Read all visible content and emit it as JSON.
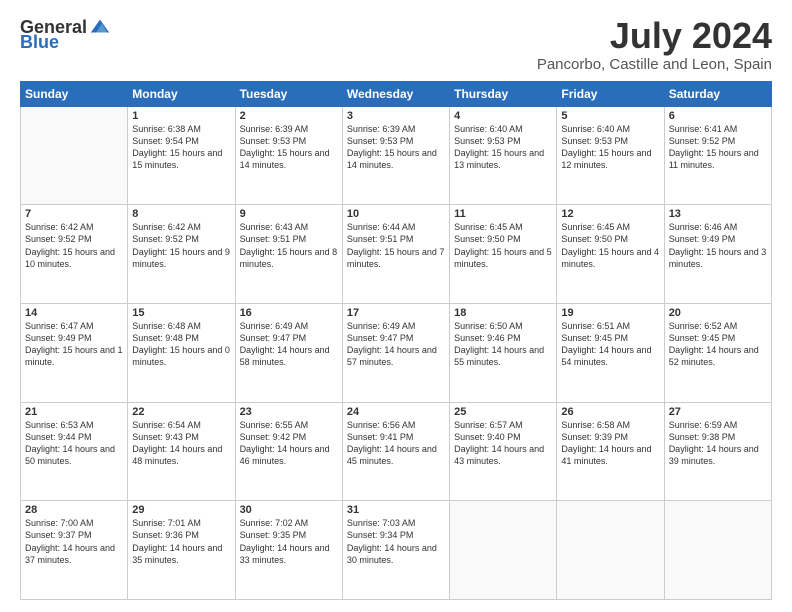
{
  "logo": {
    "general": "General",
    "blue": "Blue"
  },
  "title": "July 2024",
  "location": "Pancorbo, Castille and Leon, Spain",
  "weekdays": [
    "Sunday",
    "Monday",
    "Tuesday",
    "Wednesday",
    "Thursday",
    "Friday",
    "Saturday"
  ],
  "weeks": [
    [
      {
        "day": "",
        "sunrise": "",
        "sunset": "",
        "daylight": "",
        "empty": true
      },
      {
        "day": "1",
        "sunrise": "Sunrise: 6:38 AM",
        "sunset": "Sunset: 9:54 PM",
        "daylight": "Daylight: 15 hours and 15 minutes."
      },
      {
        "day": "2",
        "sunrise": "Sunrise: 6:39 AM",
        "sunset": "Sunset: 9:53 PM",
        "daylight": "Daylight: 15 hours and 14 minutes."
      },
      {
        "day": "3",
        "sunrise": "Sunrise: 6:39 AM",
        "sunset": "Sunset: 9:53 PM",
        "daylight": "Daylight: 15 hours and 14 minutes."
      },
      {
        "day": "4",
        "sunrise": "Sunrise: 6:40 AM",
        "sunset": "Sunset: 9:53 PM",
        "daylight": "Daylight: 15 hours and 13 minutes."
      },
      {
        "day": "5",
        "sunrise": "Sunrise: 6:40 AM",
        "sunset": "Sunset: 9:53 PM",
        "daylight": "Daylight: 15 hours and 12 minutes."
      },
      {
        "day": "6",
        "sunrise": "Sunrise: 6:41 AM",
        "sunset": "Sunset: 9:52 PM",
        "daylight": "Daylight: 15 hours and 11 minutes."
      }
    ],
    [
      {
        "day": "7",
        "sunrise": "Sunrise: 6:42 AM",
        "sunset": "Sunset: 9:52 PM",
        "daylight": "Daylight: 15 hours and 10 minutes."
      },
      {
        "day": "8",
        "sunrise": "Sunrise: 6:42 AM",
        "sunset": "Sunset: 9:52 PM",
        "daylight": "Daylight: 15 hours and 9 minutes."
      },
      {
        "day": "9",
        "sunrise": "Sunrise: 6:43 AM",
        "sunset": "Sunset: 9:51 PM",
        "daylight": "Daylight: 15 hours and 8 minutes."
      },
      {
        "day": "10",
        "sunrise": "Sunrise: 6:44 AM",
        "sunset": "Sunset: 9:51 PM",
        "daylight": "Daylight: 15 hours and 7 minutes."
      },
      {
        "day": "11",
        "sunrise": "Sunrise: 6:45 AM",
        "sunset": "Sunset: 9:50 PM",
        "daylight": "Daylight: 15 hours and 5 minutes."
      },
      {
        "day": "12",
        "sunrise": "Sunrise: 6:45 AM",
        "sunset": "Sunset: 9:50 PM",
        "daylight": "Daylight: 15 hours and 4 minutes."
      },
      {
        "day": "13",
        "sunrise": "Sunrise: 6:46 AM",
        "sunset": "Sunset: 9:49 PM",
        "daylight": "Daylight: 15 hours and 3 minutes."
      }
    ],
    [
      {
        "day": "14",
        "sunrise": "Sunrise: 6:47 AM",
        "sunset": "Sunset: 9:49 PM",
        "daylight": "Daylight: 15 hours and 1 minute."
      },
      {
        "day": "15",
        "sunrise": "Sunrise: 6:48 AM",
        "sunset": "Sunset: 9:48 PM",
        "daylight": "Daylight: 15 hours and 0 minutes."
      },
      {
        "day": "16",
        "sunrise": "Sunrise: 6:49 AM",
        "sunset": "Sunset: 9:47 PM",
        "daylight": "Daylight: 14 hours and 58 minutes."
      },
      {
        "day": "17",
        "sunrise": "Sunrise: 6:49 AM",
        "sunset": "Sunset: 9:47 PM",
        "daylight": "Daylight: 14 hours and 57 minutes."
      },
      {
        "day": "18",
        "sunrise": "Sunrise: 6:50 AM",
        "sunset": "Sunset: 9:46 PM",
        "daylight": "Daylight: 14 hours and 55 minutes."
      },
      {
        "day": "19",
        "sunrise": "Sunrise: 6:51 AM",
        "sunset": "Sunset: 9:45 PM",
        "daylight": "Daylight: 14 hours and 54 minutes."
      },
      {
        "day": "20",
        "sunrise": "Sunrise: 6:52 AM",
        "sunset": "Sunset: 9:45 PM",
        "daylight": "Daylight: 14 hours and 52 minutes."
      }
    ],
    [
      {
        "day": "21",
        "sunrise": "Sunrise: 6:53 AM",
        "sunset": "Sunset: 9:44 PM",
        "daylight": "Daylight: 14 hours and 50 minutes."
      },
      {
        "day": "22",
        "sunrise": "Sunrise: 6:54 AM",
        "sunset": "Sunset: 9:43 PM",
        "daylight": "Daylight: 14 hours and 48 minutes."
      },
      {
        "day": "23",
        "sunrise": "Sunrise: 6:55 AM",
        "sunset": "Sunset: 9:42 PM",
        "daylight": "Daylight: 14 hours and 46 minutes."
      },
      {
        "day": "24",
        "sunrise": "Sunrise: 6:56 AM",
        "sunset": "Sunset: 9:41 PM",
        "daylight": "Daylight: 14 hours and 45 minutes."
      },
      {
        "day": "25",
        "sunrise": "Sunrise: 6:57 AM",
        "sunset": "Sunset: 9:40 PM",
        "daylight": "Daylight: 14 hours and 43 minutes."
      },
      {
        "day": "26",
        "sunrise": "Sunrise: 6:58 AM",
        "sunset": "Sunset: 9:39 PM",
        "daylight": "Daylight: 14 hours and 41 minutes."
      },
      {
        "day": "27",
        "sunrise": "Sunrise: 6:59 AM",
        "sunset": "Sunset: 9:38 PM",
        "daylight": "Daylight: 14 hours and 39 minutes."
      }
    ],
    [
      {
        "day": "28",
        "sunrise": "Sunrise: 7:00 AM",
        "sunset": "Sunset: 9:37 PM",
        "daylight": "Daylight: 14 hours and 37 minutes."
      },
      {
        "day": "29",
        "sunrise": "Sunrise: 7:01 AM",
        "sunset": "Sunset: 9:36 PM",
        "daylight": "Daylight: 14 hours and 35 minutes."
      },
      {
        "day": "30",
        "sunrise": "Sunrise: 7:02 AM",
        "sunset": "Sunset: 9:35 PM",
        "daylight": "Daylight: 14 hours and 33 minutes."
      },
      {
        "day": "31",
        "sunrise": "Sunrise: 7:03 AM",
        "sunset": "Sunset: 9:34 PM",
        "daylight": "Daylight: 14 hours and 30 minutes."
      },
      {
        "day": "",
        "empty": true
      },
      {
        "day": "",
        "empty": true
      },
      {
        "day": "",
        "empty": true
      }
    ]
  ]
}
